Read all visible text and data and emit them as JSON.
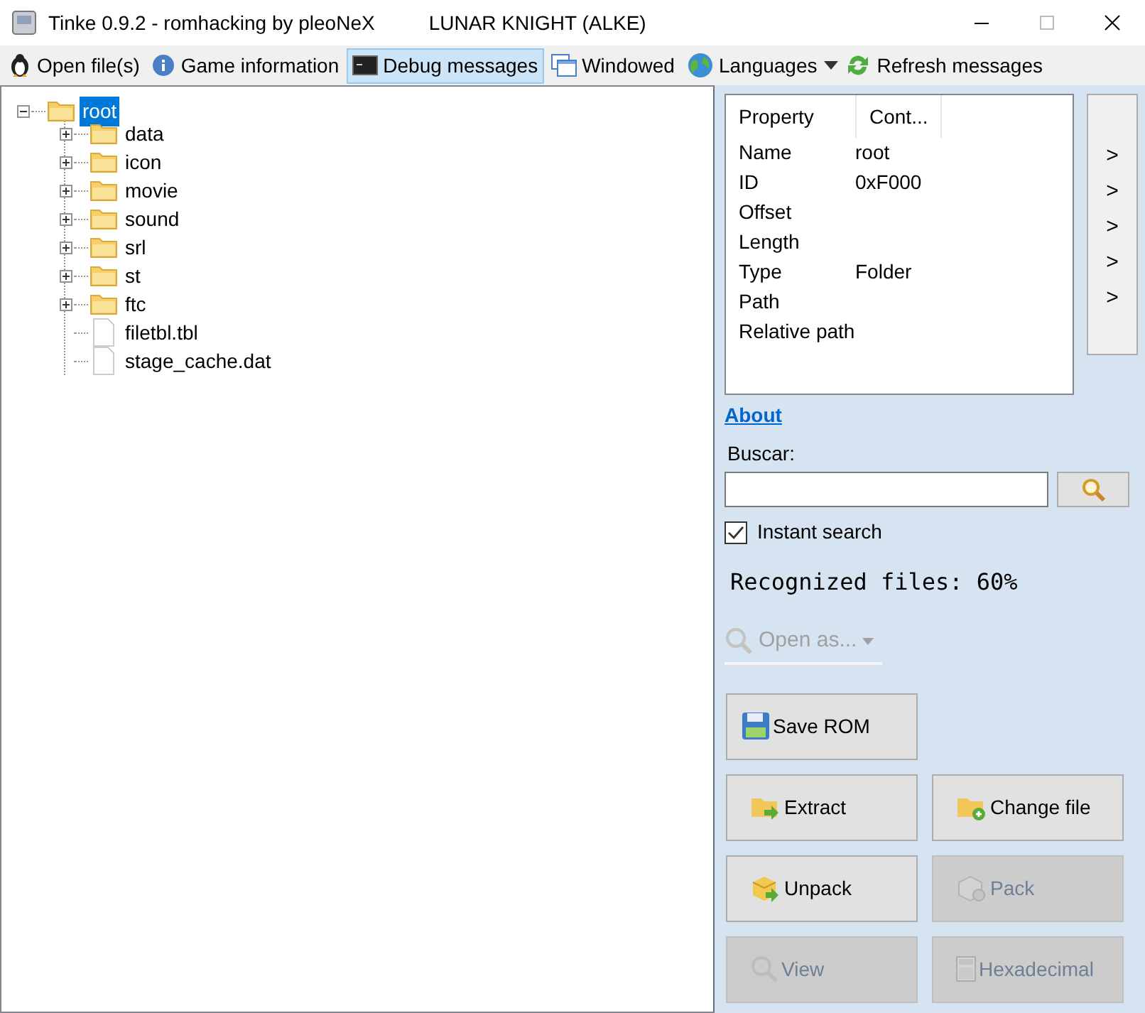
{
  "window": {
    "title": "Tinke 0.9.2 - romhacking by pleoNeX",
    "subtitle": "LUNAR KNIGHT (ALKE)"
  },
  "toolbar": [
    {
      "label": "Open file(s)",
      "kind": "penguin",
      "selected": false
    },
    {
      "label": "Game information",
      "kind": "info",
      "selected": false
    },
    {
      "label": "Debug messages",
      "kind": "console",
      "selected": true
    },
    {
      "label": "Windowed",
      "kind": "windows",
      "selected": false
    },
    {
      "label": "Languages",
      "kind": "globe",
      "selected": false,
      "dropdown": true
    },
    {
      "label": "Refresh messages",
      "kind": "refresh",
      "selected": false
    }
  ],
  "tree": {
    "label": "root",
    "kind": "folder",
    "expanded": true,
    "selected": true,
    "children": [
      {
        "label": "data",
        "kind": "folder",
        "expanded": false,
        "selected": false
      },
      {
        "label": "icon",
        "kind": "folder",
        "expanded": false,
        "selected": false
      },
      {
        "label": "movie",
        "kind": "folder",
        "expanded": false,
        "selected": false
      },
      {
        "label": "sound",
        "kind": "folder",
        "expanded": false,
        "selected": false
      },
      {
        "label": "srl",
        "kind": "folder",
        "expanded": false,
        "selected": false
      },
      {
        "label": "st",
        "kind": "folder",
        "expanded": false,
        "selected": false
      },
      {
        "label": "ftc",
        "kind": "folder",
        "expanded": false,
        "selected": false
      },
      {
        "label": "filetbl.tbl",
        "kind": "file",
        "selected": false
      },
      {
        "label": "stage_cache.dat",
        "kind": "file",
        "selected": false
      }
    ]
  },
  "properties": {
    "columns": [
      "Property",
      "Cont..."
    ],
    "rows": [
      [
        "Name",
        "root"
      ],
      [
        "ID",
        "0xF000"
      ],
      [
        "Offset",
        ""
      ],
      [
        "Length",
        ""
      ],
      [
        "Type",
        "Folder"
      ],
      [
        "Path",
        ""
      ],
      [
        "Relative path",
        ""
      ]
    ]
  },
  "side_buttons": [
    ">",
    ">",
    ">",
    ">",
    ">"
  ],
  "about_link": "About",
  "search": {
    "label": "Buscar:"
  },
  "instant_search": {
    "label": "Instant search",
    "checked": true
  },
  "recognized": "Recognized files: 60%",
  "open_as": {
    "label": "Open as...",
    "disabled": true
  },
  "actions": [
    {
      "label": "Save ROM",
      "kind": "save",
      "disabled": false
    },
    {
      "label": "Extract",
      "kind": "extract",
      "disabled": false
    },
    {
      "label": "Change file",
      "kind": "change",
      "disabled": false
    },
    {
      "label": "Unpack",
      "kind": "unpack",
      "disabled": false
    },
    {
      "label": "Pack",
      "kind": "pack",
      "disabled": true
    },
    {
      "label": "View",
      "kind": "view",
      "disabled": true
    },
    {
      "label": "Hexadecimal",
      "kind": "hex",
      "disabled": true
    }
  ]
}
